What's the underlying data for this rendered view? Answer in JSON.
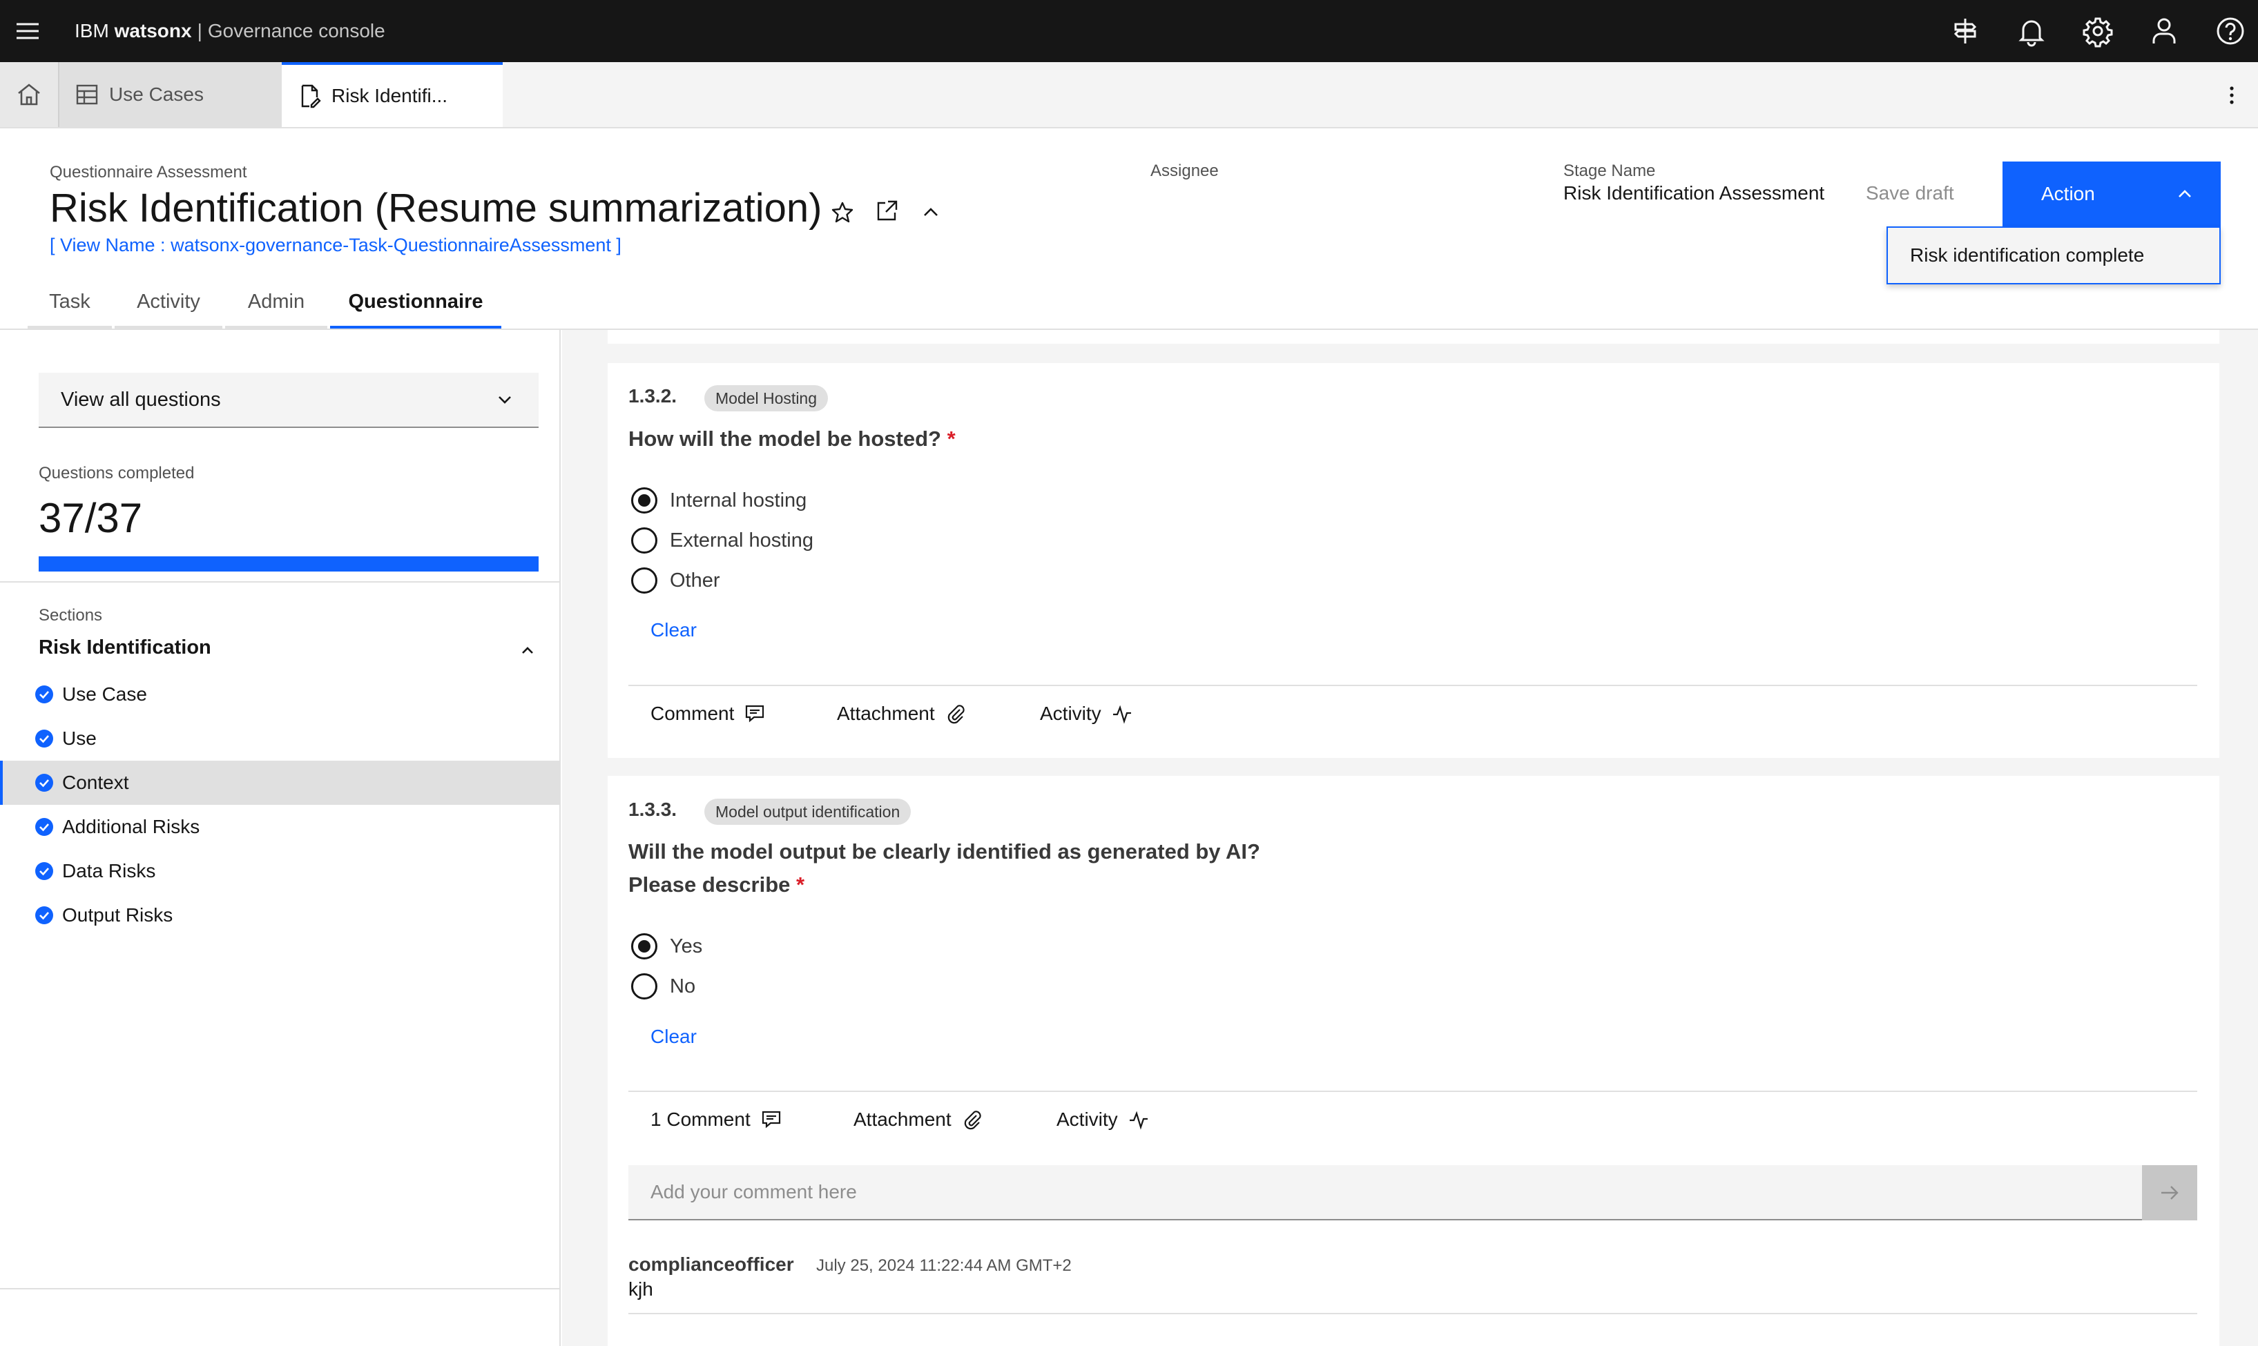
{
  "app": {
    "brand_company": "IBM",
    "brand_product": "watsonx",
    "brand_separator": "|",
    "brand_console": "Governance console",
    "header_icons": [
      "signpost-icon",
      "notification-icon",
      "settings-icon",
      "user-icon",
      "help-icon"
    ]
  },
  "workspace_tabs": [
    {
      "label": "Use Cases",
      "icon": "table-icon"
    },
    {
      "label": "Risk Identifi...",
      "icon": "document-icon",
      "active": true
    }
  ],
  "header": {
    "type_label": "Questionnaire Assessment",
    "title": "Risk Identification (Resume summarization)",
    "view_name": "[ View Name : watsonx-governance-Task-QuestionnaireAssessment ]",
    "assignee_label": "Assignee",
    "stage_label": "Stage Name",
    "stage_value": "Risk Identification Assessment",
    "save_draft": "Save draft",
    "action_label": "Action",
    "action_menu_item": "Risk identification complete"
  },
  "page_tabs": [
    "Task",
    "Activity",
    "Admin",
    "Questionnaire"
  ],
  "active_page_tab": "Questionnaire",
  "sidebar": {
    "view_select": "View all questions",
    "questions_completed_label": "Questions completed",
    "questions_completed_value": "37/37",
    "progress_fraction": 1.0,
    "sections_label": "Sections",
    "section_title": "Risk Identification",
    "items": [
      {
        "label": "Use Case"
      },
      {
        "label": "Use"
      },
      {
        "label": "Context",
        "active": true
      },
      {
        "label": "Additional Risks"
      },
      {
        "label": "Data Risks"
      },
      {
        "label": "Output Risks"
      }
    ]
  },
  "questions": [
    {
      "number": "1.3.2.",
      "tag": "Model Hosting",
      "text": "How will the model be hosted?",
      "required": "*",
      "options": [
        {
          "label": "Internal hosting",
          "selected": true
        },
        {
          "label": "External hosting",
          "selected": false
        },
        {
          "label": "Other",
          "selected": false
        }
      ],
      "clear": "Clear",
      "footer": {
        "comment": "Comment",
        "attachment": "Attachment",
        "activity": "Activity"
      }
    },
    {
      "number": "1.3.3.",
      "tag": "Model output identification",
      "text_line1": "Will the model output be clearly identified as generated by AI?",
      "text_line2": "Please describe",
      "required": "*",
      "options": [
        {
          "label": "Yes",
          "selected": true
        },
        {
          "label": "No",
          "selected": false
        }
      ],
      "clear": "Clear",
      "footer": {
        "comment": "1 Comment",
        "attachment": "Attachment",
        "activity": "Activity"
      },
      "comment_placeholder": "Add your comment here",
      "comments": [
        {
          "author": "complianceofficer",
          "date": "July 25, 2024 11:22:44 AM GMT+2",
          "text": "kjh"
        }
      ]
    }
  ],
  "colors": {
    "accent": "#0f62fe",
    "header_bg": "#161616",
    "required": "#da1e28"
  }
}
